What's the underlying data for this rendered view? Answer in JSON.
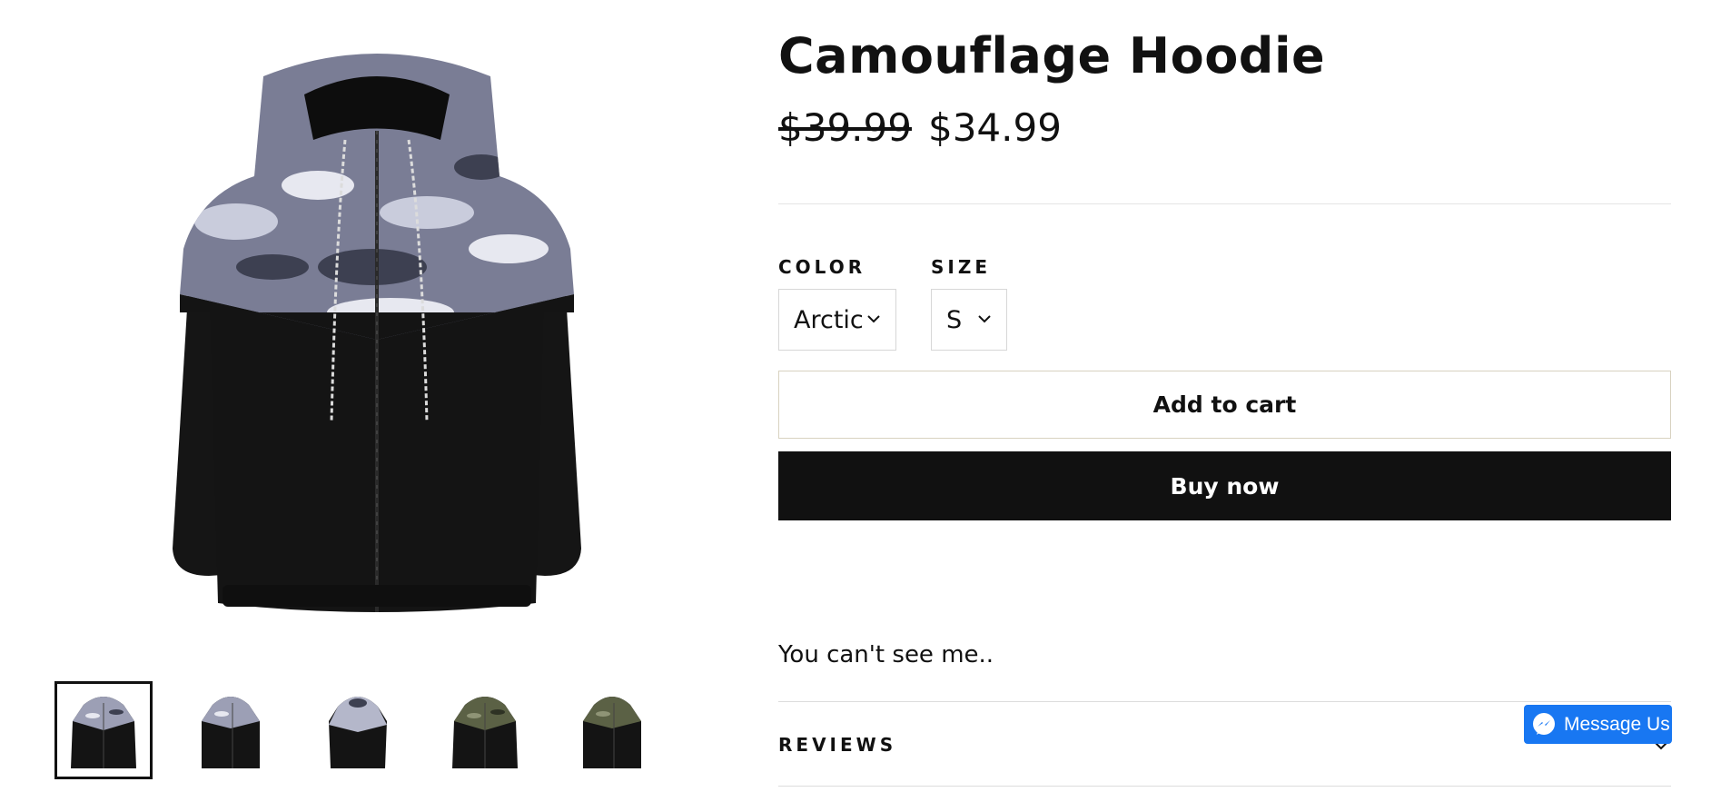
{
  "product": {
    "title": "Camouflage Hoodie",
    "price_original": "$39.99",
    "price_sale": "$34.99",
    "description": "You can't see me.."
  },
  "options": {
    "color": {
      "label": "COLOR",
      "value": "Arctic"
    },
    "size": {
      "label": "SIZE",
      "value": "S"
    }
  },
  "actions": {
    "add_to_cart": "Add to cart",
    "buy_now": "Buy now"
  },
  "reviews": {
    "label": "REVIEWS"
  },
  "messenger": {
    "label": "Message Us"
  },
  "gallery": {
    "thumbnails": [
      {
        "variant": "arctic-front",
        "active": true
      },
      {
        "variant": "arctic-angle",
        "active": false
      },
      {
        "variant": "arctic-back",
        "active": false
      },
      {
        "variant": "woodland-front",
        "active": false
      },
      {
        "variant": "woodland-angle",
        "active": false
      }
    ]
  },
  "colors": {
    "text": "#111111",
    "buy_button_bg": "#111111",
    "messenger_blue": "#1877f2",
    "camo_arctic": [
      "#7a7d95",
      "#c9ccdc",
      "#3d4051"
    ],
    "camo_woodland": [
      "#5b6145",
      "#8f9476",
      "#2e3224"
    ]
  }
}
